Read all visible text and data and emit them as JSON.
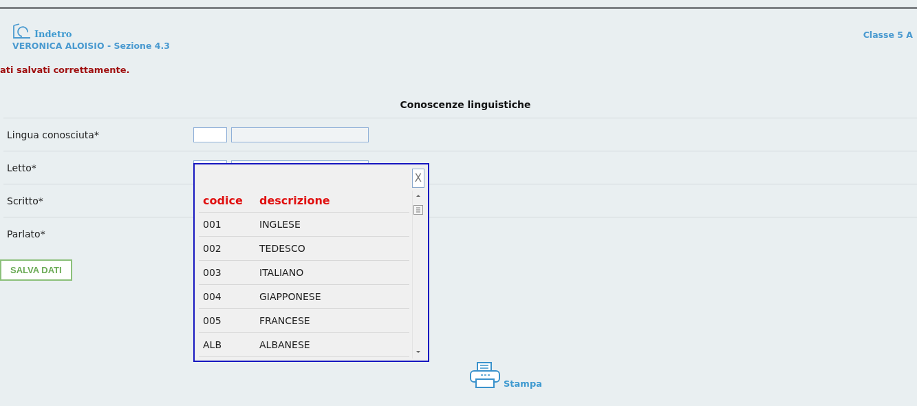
{
  "header": {
    "back_link": "Indetro",
    "student": "VERONICA ALOISIO - Sezione 4.3",
    "class_label": "Classe 5 A"
  },
  "message": "ati salvati correttamente.",
  "section_title": "Conoscenze linguistiche",
  "fields": [
    {
      "label": "Lingua conosciuta*"
    },
    {
      "label": "Letto*"
    },
    {
      "label": "Scritto*"
    },
    {
      "label": "Parlato*"
    }
  ],
  "save_button": "SALVA DATI",
  "popup": {
    "close": "X",
    "columns": [
      "codice",
      "descrizione"
    ],
    "rows": [
      {
        "code": "001",
        "description": "INGLESE"
      },
      {
        "code": "002",
        "description": "TEDESCO"
      },
      {
        "code": "003",
        "description": "ITALIANO"
      },
      {
        "code": "004",
        "description": "GIAPPONESE"
      },
      {
        "code": "005",
        "description": "FRANCESE"
      },
      {
        "code": "ALB",
        "description": "ALBANESE"
      }
    ]
  },
  "print_link": "Stampa"
}
